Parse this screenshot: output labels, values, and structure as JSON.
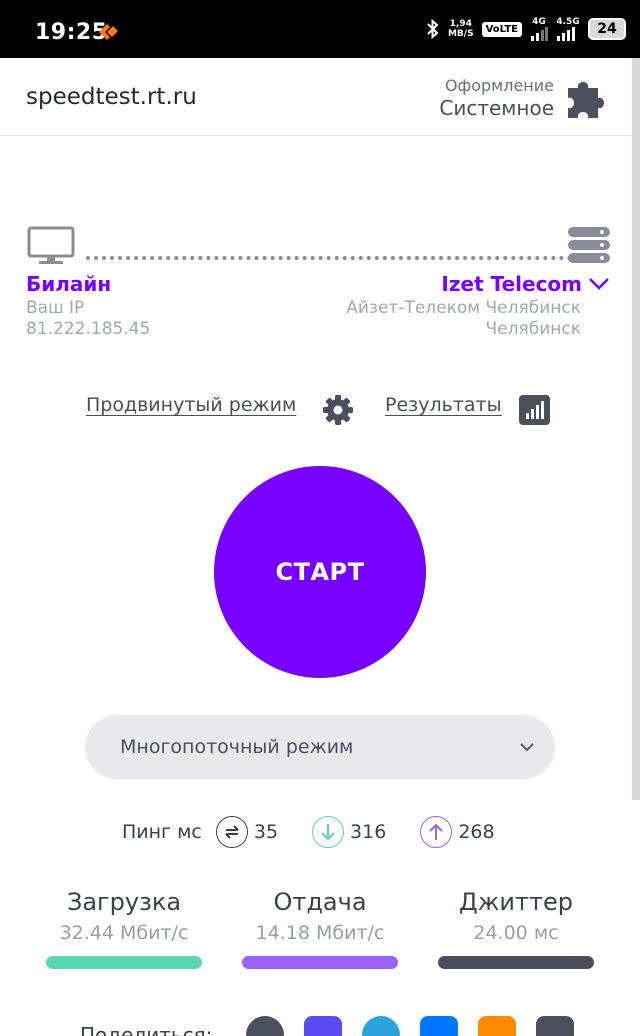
{
  "status_bar": {
    "time": "19:25",
    "net_speed_value": "1,94",
    "net_speed_unit": "MB/S",
    "volte": "VoLTE",
    "sim1": "4G",
    "sim2": "4.5G",
    "battery": "24"
  },
  "header": {
    "brand": "speedtest.rt.ru",
    "theme_label": "Оформление",
    "theme_value": "Системное"
  },
  "client": {
    "isp": "Билайн",
    "ip_label": "Ваш IP",
    "ip": "81.222.185.45"
  },
  "server": {
    "name": "Izet Telecom",
    "full_name": "Айзет-Телеком Челябинск",
    "city": "Челябинск"
  },
  "links": {
    "advanced": "Продвинутый режим",
    "results": "Результаты"
  },
  "start_button": "СТАРТ",
  "mode_select": {
    "selected": "Многопоточный режим"
  },
  "ping": {
    "label": "Пинг мс",
    "values": [
      "35",
      "316",
      "268"
    ]
  },
  "stats": [
    {
      "name": "Загрузка",
      "value": "32.44",
      "unit": "Мбит/с",
      "color": "#5cd6b2"
    },
    {
      "name": "Отдача",
      "value": "14.18",
      "unit": "Мбит/с",
      "color": "#9b63f5"
    },
    {
      "name": "Джиттер",
      "value": "24.00",
      "unit": "мс",
      "color": "#4b4e5a"
    }
  ],
  "share": {
    "label": "Поделиться:"
  },
  "colors": {
    "accent": "#7700ff",
    "text": "#3d404c",
    "muted": "#a3a5af"
  }
}
